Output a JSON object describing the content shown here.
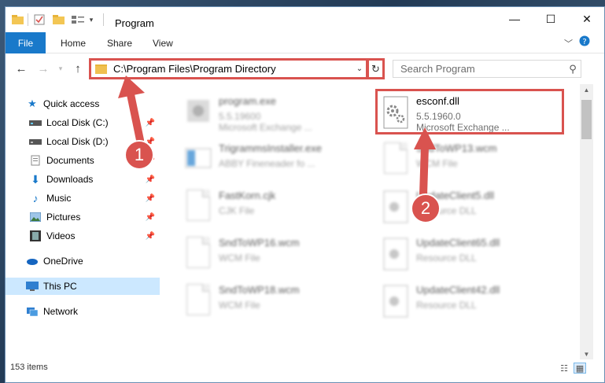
{
  "window": {
    "title": "Program",
    "controls": {
      "minimize": "—",
      "maximize": "☐",
      "close": "✕"
    }
  },
  "ribbon": {
    "file": "File",
    "tabs": [
      "Home",
      "Share",
      "View"
    ]
  },
  "address": {
    "path": "C:\\Program Files\\Program Directory",
    "search_placeholder": "Search Program"
  },
  "sidebar": {
    "items": [
      {
        "label": "Quick access",
        "icon": "star-icon",
        "pinned": false
      },
      {
        "label": "Local Disk (C:)",
        "icon": "drive-icon",
        "pinned": true
      },
      {
        "label": "Local Disk (D:)",
        "icon": "drive-icon",
        "pinned": true
      },
      {
        "label": "Documents",
        "icon": "documents-icon",
        "pinned": true
      },
      {
        "label": "Downloads",
        "icon": "download-icon",
        "pinned": true
      },
      {
        "label": "Music",
        "icon": "music-icon",
        "pinned": true
      },
      {
        "label": "Pictures",
        "icon": "pictures-icon",
        "pinned": true
      },
      {
        "label": "Videos",
        "icon": "videos-icon",
        "pinned": true
      },
      {
        "label": "OneDrive",
        "icon": "cloud-icon",
        "pinned": false
      },
      {
        "label": "This PC",
        "icon": "computer-icon",
        "pinned": false
      },
      {
        "label": "Network",
        "icon": "network-icon",
        "pinned": false
      }
    ]
  },
  "files": {
    "left": [
      {
        "name": "program.exe",
        "line1": "5.5.19600",
        "line2": "Microsoft Exchange ..."
      },
      {
        "name": "TrigrammsInstaller.exe",
        "line1": "ABBY Fineneader fo ..."
      },
      {
        "name": "FastKorn.cjk",
        "line1": "CJK File"
      },
      {
        "name": "SndToWP16.wcm",
        "line1": "WCM File"
      },
      {
        "name": "SndToWP18.wcm",
        "line1": "WCM File"
      }
    ],
    "right": [
      {
        "name": "esconf.dll",
        "line1": "5.5.1960.0",
        "line2": "Microsoft Exchange ..."
      },
      {
        "name": "SndToWP13.wcm",
        "line1": "WCM File"
      },
      {
        "name": "UpdateClient5.dll",
        "line1": "Resource DLL"
      },
      {
        "name": "UpdateClient65.dll",
        "line1": "Resource DLL"
      },
      {
        "name": "UpdateClient42.dll",
        "line1": "Resource DLL"
      }
    ]
  },
  "status": {
    "items": "153 items"
  },
  "annotations": {
    "step1": "1",
    "step2": "2",
    "color": "#d9534f"
  }
}
